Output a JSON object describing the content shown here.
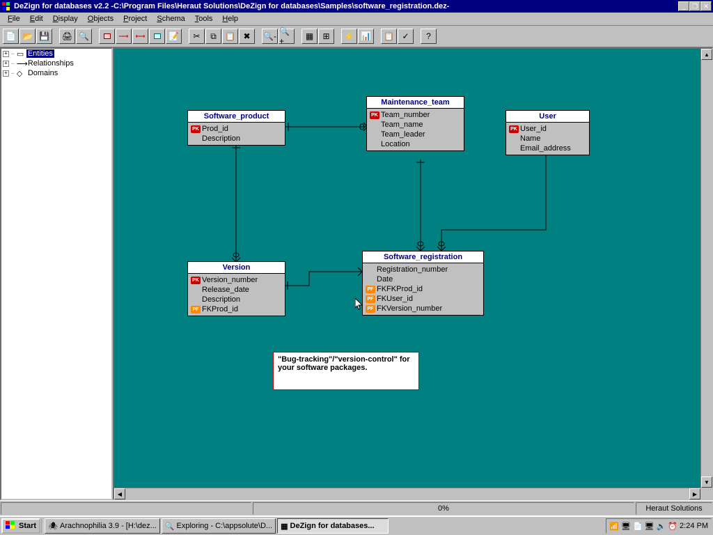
{
  "titlebar": {
    "text": "DeZign for databases v2.2 -C:\\Program Files\\Heraut Solutions\\DeZign for databases\\Samples\\software_registration.dez-"
  },
  "menu": [
    "File",
    "Edit",
    "Display",
    "Objects",
    "Project",
    "Schema",
    "Tools",
    "Help"
  ],
  "tree": {
    "entities": "Entities",
    "relationships": "Relationships",
    "domains": "Domains"
  },
  "entities": {
    "software_product": {
      "title": "Software_product",
      "rows": [
        {
          "key": "PK",
          "label": "Prod_id"
        },
        {
          "key": "",
          "label": "Description"
        }
      ]
    },
    "maintenance_team": {
      "title": "Maintenance_team",
      "rows": [
        {
          "key": "PK",
          "label": "Team_number"
        },
        {
          "key": "",
          "label": "Team_name"
        },
        {
          "key": "",
          "label": "Team_leader"
        },
        {
          "key": "",
          "label": "Location"
        }
      ]
    },
    "user": {
      "title": "User",
      "rows": [
        {
          "key": "PK",
          "label": "User_id"
        },
        {
          "key": "",
          "label": "Name"
        },
        {
          "key": "",
          "label": "Email_address"
        }
      ]
    },
    "version": {
      "title": "Version",
      "rows": [
        {
          "key": "PK",
          "label": "Version_number"
        },
        {
          "key": "",
          "label": "Release_date"
        },
        {
          "key": "",
          "label": "Description"
        },
        {
          "key": "PF",
          "label": "FKProd_id"
        }
      ]
    },
    "software_registration": {
      "title": "Software_registration",
      "rows": [
        {
          "key": "",
          "label": "Registration_number"
        },
        {
          "key": "",
          "label": "Date"
        },
        {
          "key": "PF",
          "label": "FKFKProd_id"
        },
        {
          "key": "PF",
          "label": "FKUser_id"
        },
        {
          "key": "PF",
          "label": "FKVersion_number"
        }
      ]
    }
  },
  "note": "\"Bug-tracking\"/\"version-control\" for your software packages.",
  "status": {
    "percent": "0%",
    "vendor": "Heraut Solutions"
  },
  "taskbar": {
    "start": "Start",
    "tasks": [
      "Arachnophilia 3.9 - [H:\\dez...",
      "Exploring - C:\\appsolute\\D...",
      "DeZign for databases..."
    ],
    "clock": "2:24 PM"
  },
  "chart_data": {
    "type": "diagram",
    "entities": [
      {
        "name": "Software_product",
        "attributes": [
          {
            "name": "Prod_id",
            "pk": true
          },
          {
            "name": "Description"
          }
        ]
      },
      {
        "name": "Maintenance_team",
        "attributes": [
          {
            "name": "Team_number",
            "pk": true
          },
          {
            "name": "Team_name"
          },
          {
            "name": "Team_leader"
          },
          {
            "name": "Location"
          }
        ]
      },
      {
        "name": "User",
        "attributes": [
          {
            "name": "User_id",
            "pk": true
          },
          {
            "name": "Name"
          },
          {
            "name": "Email_address"
          }
        ]
      },
      {
        "name": "Version",
        "attributes": [
          {
            "name": "Version_number",
            "pk": true
          },
          {
            "name": "Release_date"
          },
          {
            "name": "Description"
          },
          {
            "name": "FKProd_id",
            "fk": true
          }
        ]
      },
      {
        "name": "Software_registration",
        "attributes": [
          {
            "name": "Registration_number"
          },
          {
            "name": "Date"
          },
          {
            "name": "FKFKProd_id",
            "fk": true
          },
          {
            "name": "FKUser_id",
            "fk": true
          },
          {
            "name": "FKVersion_number",
            "fk": true
          }
        ]
      }
    ],
    "relationships": [
      {
        "from": "Software_product",
        "to": "Maintenance_team"
      },
      {
        "from": "Software_product",
        "to": "Version"
      },
      {
        "from": "Version",
        "to": "Software_registration"
      },
      {
        "from": "Maintenance_team",
        "to": "Software_registration"
      },
      {
        "from": "User",
        "to": "Software_registration"
      }
    ],
    "annotation": "\"Bug-tracking\"/\"version-control\" for your software packages."
  }
}
